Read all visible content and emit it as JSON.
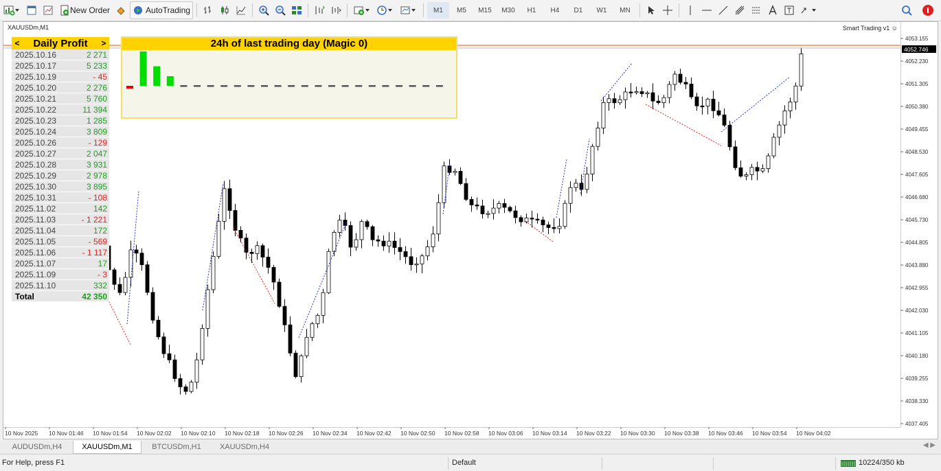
{
  "toolbar": {
    "new_order_label": "New Order",
    "autotrading_label": "AutoTrading",
    "timeframes": [
      "M1",
      "M5",
      "M15",
      "M30",
      "H1",
      "H4",
      "D1",
      "W1",
      "MN"
    ],
    "active_timeframe": "M1"
  },
  "chart": {
    "symbol_label": "XAUUSDm,M1",
    "ea_label": "Smart Trading v1 ☺",
    "price_labels": [
      "4053.155",
      "4052.230",
      "4051.305",
      "4050.380",
      "4049.455",
      "4048.530",
      "4047.605",
      "4046.680",
      "4045.730",
      "4044.805",
      "4043.880",
      "4042.955",
      "4042.030",
      "4041.105",
      "4040.180",
      "4039.255",
      "4038.330",
      "4037.405"
    ],
    "current_price": "4052.746",
    "current_price_color": "#000000",
    "ask_line_color": "#ff4500",
    "time_labels": [
      "10 Nov 2025",
      "10 Nov 01:46",
      "10 Nov 01:54",
      "10 Nov 02:02",
      "10 Nov 02:10",
      "10 Nov 02:18",
      "10 Nov 02:26",
      "10 Nov 02:34",
      "10 Nov 02:42",
      "10 Nov 02:50",
      "10 Nov 02:58",
      "10 Nov 03:06",
      "10 Nov 03:14",
      "10 Nov 03:22",
      "10 Nov 03:30",
      "10 Nov 03:38",
      "10 Nov 03:46",
      "10 Nov 03:54",
      "10 Nov 04:02"
    ]
  },
  "daily_profit": {
    "arrow_left": "<",
    "title": "Daily Profit",
    "arrow_right": ">",
    "rows": [
      {
        "date": "2025.10.16",
        "value": "2 271",
        "sign": "pos"
      },
      {
        "date": "2025.10.17",
        "value": "5 233",
        "sign": "pos"
      },
      {
        "date": "2025.10.19",
        "value": "- 45",
        "sign": "neg"
      },
      {
        "date": "2025.10.20",
        "value": "2 276",
        "sign": "pos"
      },
      {
        "date": "2025.10.21",
        "value": "5 760",
        "sign": "pos"
      },
      {
        "date": "2025.10.22",
        "value": "11 394",
        "sign": "pos"
      },
      {
        "date": "2025.10.23",
        "value": "1 285",
        "sign": "pos"
      },
      {
        "date": "2025.10.24",
        "value": "3 809",
        "sign": "pos"
      },
      {
        "date": "2025.10.26",
        "value": "- 129",
        "sign": "neg"
      },
      {
        "date": "2025.10.27",
        "value": "2 047",
        "sign": "pos"
      },
      {
        "date": "2025.10.28",
        "value": "3 931",
        "sign": "pos"
      },
      {
        "date": "2025.10.29",
        "value": "2 978",
        "sign": "pos"
      },
      {
        "date": "2025.10.30",
        "value": "3 895",
        "sign": "pos"
      },
      {
        "date": "2025.10.31",
        "value": "- 108",
        "sign": "neg"
      },
      {
        "date": "2025.11.02",
        "value": "142",
        "sign": "pos"
      },
      {
        "date": "2025.11.03",
        "value": "- 1 221",
        "sign": "neg"
      },
      {
        "date": "2025.11.04",
        "value": "172",
        "sign": "pos"
      },
      {
        "date": "2025.11.05",
        "value": "- 569",
        "sign": "neg"
      },
      {
        "date": "2025.11.06",
        "value": "- 1 117",
        "sign": "neg"
      },
      {
        "date": "2025.11.07",
        "value": "17",
        "sign": "pos"
      },
      {
        "date": "2025.11.09",
        "value": "- 3",
        "sign": "neg"
      },
      {
        "date": "2025.11.10",
        "value": "332",
        "sign": "pos"
      }
    ],
    "total_label": "Total",
    "total_value": "42 350"
  },
  "last_day": {
    "title": "24h of last trading day (Magic 0)",
    "hourly_bars": [
      -0.07,
      1.0,
      0.57,
      0.28,
      0,
      0,
      0,
      0,
      0,
      0,
      0,
      0,
      0,
      0,
      0,
      0,
      0,
      0,
      0,
      0,
      0,
      0,
      0,
      0
    ],
    "pos_color": "#00dd00",
    "neg_color": "#ee0000"
  },
  "tabs": [
    {
      "label": "AUDUSDm,H4",
      "active": false
    },
    {
      "label": "XAUUSDm,M1",
      "active": true
    },
    {
      "label": "BTCUSDm,H1",
      "active": false
    },
    {
      "label": "XAUUSDm,H4",
      "active": false
    }
  ],
  "status": {
    "help": "For Help, press F1",
    "profile": "Default",
    "network": "10224/350 kb"
  }
}
